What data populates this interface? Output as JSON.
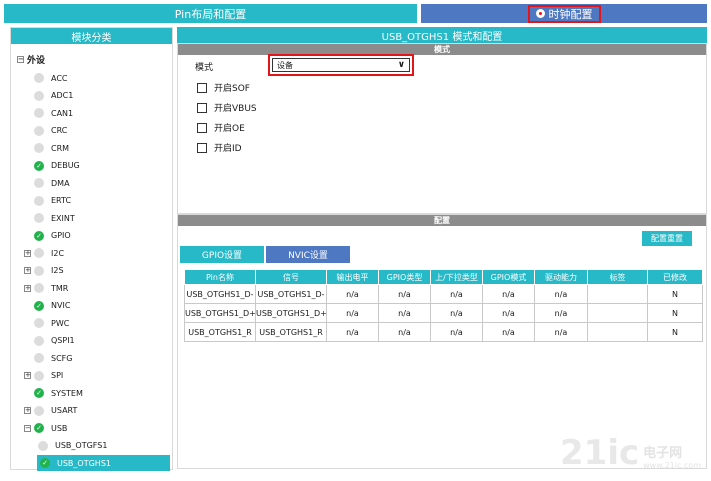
{
  "tabs": {
    "pin_layout": "Pin布局和配置",
    "clock_config": "时钟配置"
  },
  "left": {
    "title": "模块分类",
    "root_label": "外设",
    "items": [
      {
        "label": "ACC",
        "status": "gray",
        "expandable": false
      },
      {
        "label": "ADC1",
        "status": "gray",
        "expandable": false
      },
      {
        "label": "CAN1",
        "status": "gray",
        "expandable": false
      },
      {
        "label": "CRC",
        "status": "gray",
        "expandable": false
      },
      {
        "label": "CRM",
        "status": "gray",
        "expandable": false
      },
      {
        "label": "DEBUG",
        "status": "green",
        "expandable": false
      },
      {
        "label": "DMA",
        "status": "gray",
        "expandable": false
      },
      {
        "label": "ERTC",
        "status": "gray",
        "expandable": false
      },
      {
        "label": "EXINT",
        "status": "gray",
        "expandable": false
      },
      {
        "label": "GPIO",
        "status": "green",
        "expandable": false
      },
      {
        "label": "I2C",
        "status": "gray",
        "expandable": true
      },
      {
        "label": "I2S",
        "status": "gray",
        "expandable": true
      },
      {
        "label": "TMR",
        "status": "gray",
        "expandable": true
      },
      {
        "label": "NVIC",
        "status": "green",
        "expandable": false
      },
      {
        "label": "PWC",
        "status": "gray",
        "expandable": false
      },
      {
        "label": "QSPI1",
        "status": "gray",
        "expandable": false
      },
      {
        "label": "SCFG",
        "status": "gray",
        "expandable": false
      },
      {
        "label": "SPI",
        "status": "gray",
        "expandable": true
      },
      {
        "label": "SYSTEM",
        "status": "green",
        "expandable": false
      },
      {
        "label": "USART",
        "status": "gray",
        "expandable": true
      },
      {
        "label": "USB",
        "status": "green",
        "expandable": true
      }
    ],
    "usb_children": [
      {
        "label": "USB_OTGFS1",
        "status": "gray"
      },
      {
        "label": "USB_OTGHS1",
        "status": "green",
        "selected": true
      }
    ]
  },
  "main": {
    "title": "USB_OTGHS1 模式和配置",
    "mode_section": "模式",
    "mode_label": "模式",
    "mode_value": "设备",
    "checkboxes": [
      "开启SOF",
      "开启VBUS",
      "开启OE",
      "开启ID"
    ],
    "config_section": "配置",
    "reset_button": "配置重置",
    "sub_tabs": [
      "GPIO设置",
      "NVIC设置"
    ],
    "table": {
      "headers": [
        "Pin名称",
        "信号",
        "输出电平",
        "GPIO类型",
        "上/下拉类型",
        "GPIO模式",
        "驱动能力",
        "标签",
        "已修改"
      ],
      "rows": [
        [
          "USB_OTGHS1_D-",
          "USB_OTGHS1_D-",
          "n/a",
          "n/a",
          "n/a",
          "n/a",
          "n/a",
          "",
          "N"
        ],
        [
          "USB_OTGHS1_D+",
          "USB_OTGHS1_D+",
          "n/a",
          "n/a",
          "n/a",
          "n/a",
          "n/a",
          "",
          "N"
        ],
        [
          "USB_OTGHS1_R",
          "USB_OTGHS1_R",
          "n/a",
          "n/a",
          "n/a",
          "n/a",
          "n/a",
          "",
          "N"
        ]
      ]
    }
  },
  "watermark": {
    "big": "21ic",
    "cn": "电子网",
    "url": "www.21ic.com"
  },
  "colors": {
    "accent": "#27b9c7",
    "tab_blue": "#4f78c3",
    "highlight_red": "#e3151a",
    "status_green": "#22b24c"
  }
}
